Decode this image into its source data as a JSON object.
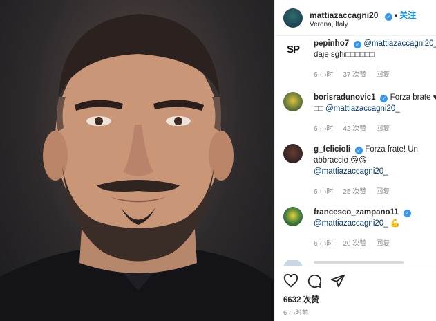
{
  "post": {
    "author": "mattiazaccagni20_",
    "follow_label": "关注",
    "dot": "•",
    "location": "Verona, Italy"
  },
  "comments": [
    {
      "user": "pepinho7",
      "verified": true,
      "avatar_text": "SP",
      "line1": "@mattiazaccagni20_",
      "line2": "daje sghi□□□□□□",
      "time": "6 小时",
      "likes": "37 次赞",
      "reply": "回复"
    },
    {
      "user": "borisradunovic1",
      "verified": true,
      "line1_text": "Forza brate",
      "line1_symbol": "♥",
      "line2_prefix": "□□",
      "line2_mention": "@mattiazaccagni20_",
      "time": "6 小时",
      "likes": "42 次赞",
      "reply": "回复"
    },
    {
      "user": "g_felicioli",
      "verified": true,
      "line1_text": "Forza frate! Un",
      "line2_text": "abbraccio 😘😘",
      "line3_mention": "@mattiazaccagni20_",
      "time": "6 小时",
      "likes": "25 次赞",
      "reply": "回复"
    },
    {
      "user": "francesco_zampano11",
      "verified": true,
      "line2_mention": "@mattiazaccagni20_",
      "line2_emoji": "💪",
      "time": "6 小时",
      "likes": "20 次赞",
      "reply": "回复"
    }
  ],
  "actions": {
    "likes": "6632 次赞",
    "time": "6 小时前"
  },
  "colors": {
    "accent": "#0095f6",
    "verified": "#3897f0",
    "muted": "#8e8e8e",
    "mention": "#00376b"
  },
  "icons": [
    "heart-icon",
    "comment-icon",
    "share-icon",
    "verified-badge-icon"
  ]
}
